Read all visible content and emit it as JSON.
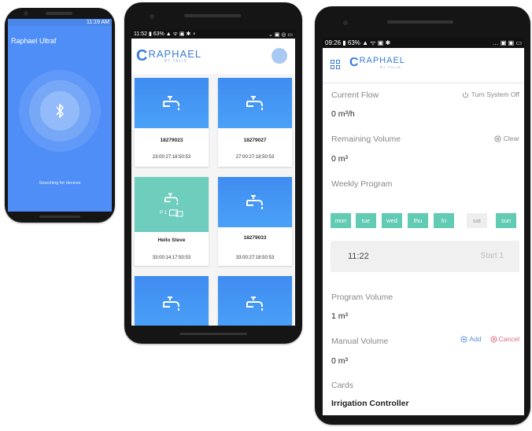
{
  "phone1": {
    "status_time": "11:19 AM",
    "title": "Raphael Ultraf",
    "scanning_text": "Searching for devices",
    "icon": "bluetooth-icon"
  },
  "phone2": {
    "status_left": "11:52 ▮ 63% ▲ ᯤ ▣ ✱ ♀",
    "status_right": "⌄ ▣ ◎ ▭",
    "logo_word": "RAPHAEL",
    "logo_sub": "BY TALIS",
    "cards": [
      {
        "name": "18279023",
        "date": "23:00:27:18:50:53"
      },
      {
        "name": "18279027",
        "date": "27:00:27:18:50:53"
      },
      {
        "name": "Hello Steve",
        "date": "33:00:14:17:50:53",
        "sub_label": "P 1"
      },
      {
        "name": "18279033",
        "date": "33:00:27:18:50:53"
      }
    ]
  },
  "phone3": {
    "status_left": "09:26 ▮ 63% ▲ ᯤ ▣ ✱",
    "status_right": "… ▣ ▣ ▭",
    "logo_word": "RAPHAEL",
    "logo_sub": "BY TALIS",
    "current_flow_label": "Current Flow",
    "current_flow_value": "0 m³/h",
    "turn_off_label": "Turn System Off",
    "remaining_volume_label": "Remaining Volume",
    "remaining_volume_value": "0 m³",
    "clear_label": "Clear",
    "weekly_program_label": "Weekly Program",
    "days": [
      {
        "label": "mon",
        "active": true
      },
      {
        "label": "tue",
        "active": true
      },
      {
        "label": "wed",
        "active": true
      },
      {
        "label": "thu",
        "active": true
      },
      {
        "label": "fri",
        "active": true
      },
      {
        "label": "sat",
        "active": false
      },
      {
        "label": "sun",
        "active": true
      }
    ],
    "program_time": "11:22",
    "program_start": "Start 1",
    "program_volume_label": "Program Volume",
    "program_volume_value": "1 m³",
    "manual_volume_label": "Manual Volume",
    "manual_volume_value": "0 m³",
    "add_label": "Add",
    "cancel_label": "Cancel",
    "cards_label": "Cards",
    "cards_value": "Irrigation Controller"
  },
  "colors": {
    "brand_blue": "#3a7bd5",
    "bluetooth_bg": "#4f8ef7",
    "card_blue": "#3f8cf1",
    "card_teal": "#6fcdbe",
    "day_active": "#62cbb3"
  }
}
